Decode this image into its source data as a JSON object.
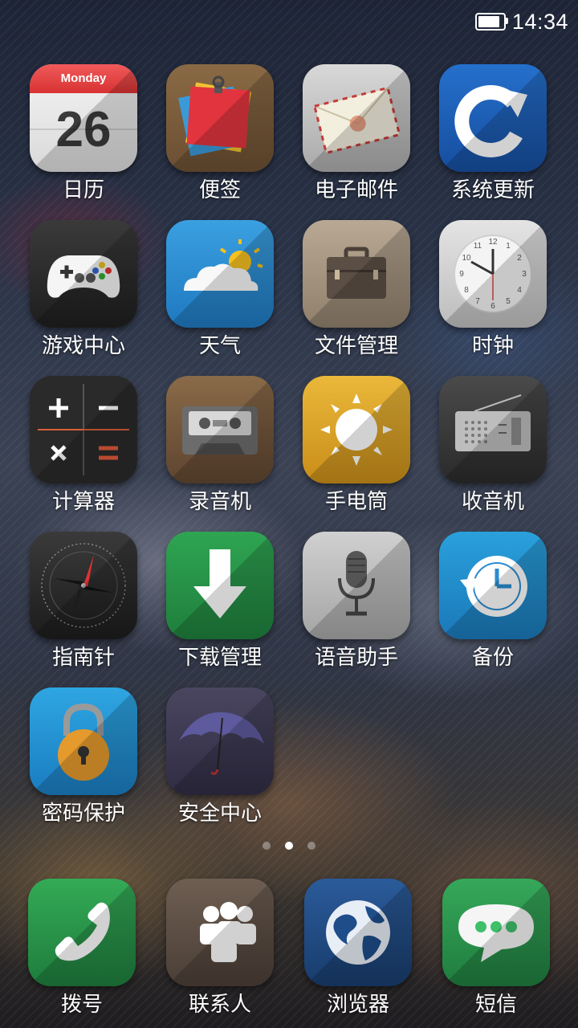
{
  "status_bar": {
    "time": "14:34"
  },
  "calendar": {
    "weekday": "Monday",
    "day": "26"
  },
  "apps": [
    {
      "label": "日历"
    },
    {
      "label": "便签"
    },
    {
      "label": "电子邮件"
    },
    {
      "label": "系统更新"
    },
    {
      "label": "游戏中心"
    },
    {
      "label": "天气"
    },
    {
      "label": "文件管理"
    },
    {
      "label": "时钟"
    },
    {
      "label": "计算器"
    },
    {
      "label": "录音机"
    },
    {
      "label": "手电筒"
    },
    {
      "label": "收音机"
    },
    {
      "label": "指南针"
    },
    {
      "label": "下载管理"
    },
    {
      "label": "语音助手"
    },
    {
      "label": "备份"
    },
    {
      "label": "密码保护"
    },
    {
      "label": "安全中心"
    }
  ],
  "dock": [
    {
      "label": "拨号"
    },
    {
      "label": "联系人"
    },
    {
      "label": "浏览器"
    },
    {
      "label": "短信"
    }
  ],
  "page_indicator": {
    "count": 3,
    "active": 2
  },
  "colors": {
    "calendar_red": "#e04040",
    "update_blue": "#1e5fbf",
    "download_green": "#2a9a48",
    "dock_phone_green": "#2c9a4a",
    "sms_green": "#2f9650",
    "flashlight_yellow": "#e0a826"
  }
}
